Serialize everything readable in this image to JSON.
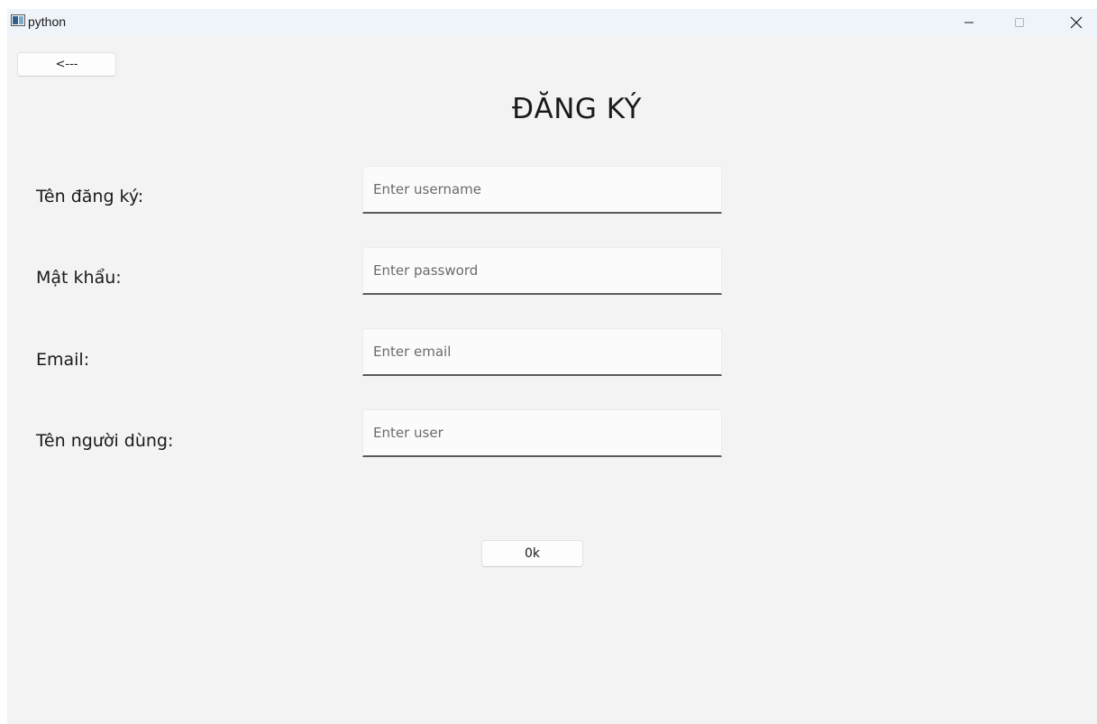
{
  "window": {
    "title": "python",
    "app_icon": "python-window-icon",
    "controls": {
      "minimize_icon": "minimize-icon",
      "maximize_icon": "maximize-icon",
      "close_icon": "close-icon"
    }
  },
  "toolbar": {
    "back_label": "<---"
  },
  "form": {
    "title": "ĐĂNG KÝ",
    "fields": [
      {
        "label": "Tên đăng ký:",
        "placeholder": "Enter username",
        "value": ""
      },
      {
        "label": "Mật khẩu:",
        "placeholder": "Enter password",
        "value": ""
      },
      {
        "label": "Email:",
        "placeholder": "Enter email",
        "value": ""
      },
      {
        "label": "Tên người dùng:",
        "placeholder": "Enter user",
        "value": ""
      }
    ],
    "submit_label": "0k"
  },
  "colors": {
    "window_background": "#f3f3f3",
    "titlebar_background": "#eff3fa",
    "input_underline": "#5a5a5a",
    "text": "#1a1a1a"
  }
}
